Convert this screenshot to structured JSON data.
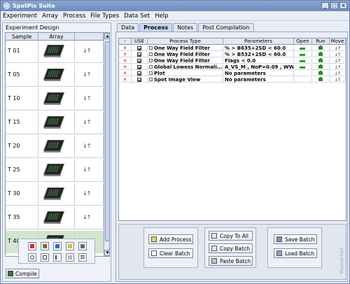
{
  "app": {
    "title": "SpotPix Suite"
  },
  "menu": [
    "Experiment",
    "Array",
    "Process",
    "File Types",
    "Data Set",
    "Help"
  ],
  "experiment_design": {
    "title": "Experiment Design",
    "columns": [
      "Sample",
      "Array",
      ""
    ],
    "samples": [
      "T 01",
      "T 05",
      "T 10",
      "T 15",
      "T 20",
      "T 25",
      "T 30",
      "T 35",
      "T 40"
    ],
    "selected_sample": "T 40",
    "move_glyph": "↓↑"
  },
  "compile_button": "Compile",
  "tabs": [
    "Data",
    "Process",
    "Notes",
    "Post Compilation"
  ],
  "active_tab": "Process",
  "process_table": {
    "columns": [
      "-",
      "USE",
      "Process Type",
      "Parameters",
      "Open",
      "Run",
      "Move"
    ],
    "rows": [
      {
        "process": "One Way Field Filter",
        "parameters": "% > B635+2SD < 60.0",
        "checked": true,
        "open": true,
        "move": "↓↑"
      },
      {
        "process": "One Way Field Filter",
        "parameters": "% > B532+2SD < 60.0",
        "checked": true,
        "open": true,
        "move": "↓↑"
      },
      {
        "process": "One Way Field Filter",
        "parameters": "Flags < 0.0",
        "checked": true,
        "open": true,
        "move": "↓↑"
      },
      {
        "process": "Global Lowess Normali...",
        "parameters": "A_VS_M , NoP=0.09 , WW...",
        "checked": true,
        "open": true,
        "move": "↓↑"
      },
      {
        "process": "Plot",
        "parameters": "No parameters",
        "checked": true,
        "open": false,
        "move": "↓↑"
      },
      {
        "process": "Spot Image View",
        "parameters": "No parameters",
        "checked": true,
        "open": false,
        "move": "↓↑"
      }
    ]
  },
  "buttons": {
    "add_process": "Add Process",
    "clear_batch": "Clear Batch",
    "copy_to_all": "Copy To All",
    "copy_batch": "Copy Batch",
    "paste_batch": "Paste Batch",
    "save_batch": "Save Batch",
    "load_batch": "Load Batch"
  },
  "watermark": "Beyond Fast",
  "colors": {
    "delete_x": "#cc1f1f",
    "selected_row": "#d2e6cf",
    "active_tab": "#c9d8f0"
  }
}
